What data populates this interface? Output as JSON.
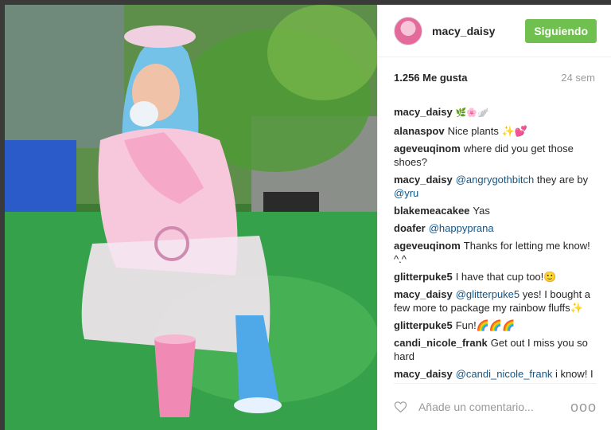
{
  "post": {
    "username": "macy_daisy",
    "follow_label": "Siguiendo",
    "likes": "1.256 Me gusta",
    "time": "24 sem",
    "comment_placeholder": "Añade un comentario...",
    "more_label": "ooo",
    "comments": [
      {
        "user": "macy_daisy",
        "text": "🌿🌸🪽",
        "mention": ""
      },
      {
        "user": "alanaspov",
        "text": "Nice plants ✨💕",
        "mention": ""
      },
      {
        "user": "ageveuqinom",
        "text": "where did you get those shoes?",
        "mention": ""
      },
      {
        "user": "macy_daisy",
        "mention": "@angrygothbitch",
        "text": " they are by ",
        "mention2": "@yru"
      },
      {
        "user": "blakemeacakee",
        "text": "Yas",
        "mention": ""
      },
      {
        "user": "doafer",
        "mention": "@happyprana",
        "text": ""
      },
      {
        "user": "ageveuqinom",
        "text": "Thanks for letting me know! ^.^",
        "mention": ""
      },
      {
        "user": "glitterpuke5",
        "text": "I have that cup too!🙂",
        "mention": ""
      },
      {
        "user": "macy_daisy",
        "mention": "@glitterpuke5",
        "text": " yes! I bought a few more to package my rainbow fluffs✨"
      },
      {
        "user": "glitterpuke5",
        "text": "Fun!🌈🌈🌈",
        "mention": ""
      },
      {
        "user": "candi_nicole_frank",
        "text": "Get out I miss you so hard",
        "mention": ""
      },
      {
        "user": "macy_daisy",
        "mention": "@candi_nicole_frank",
        "text": " i know! I miss you too! I'd love to catch up with you",
        "mention2": ""
      }
    ]
  },
  "icons": {
    "like": "heart-icon",
    "more": "more-options-icon",
    "avatar": "avatar"
  },
  "colors": {
    "follow": "#70c050",
    "mention": "#125688",
    "muted": "#999999"
  }
}
